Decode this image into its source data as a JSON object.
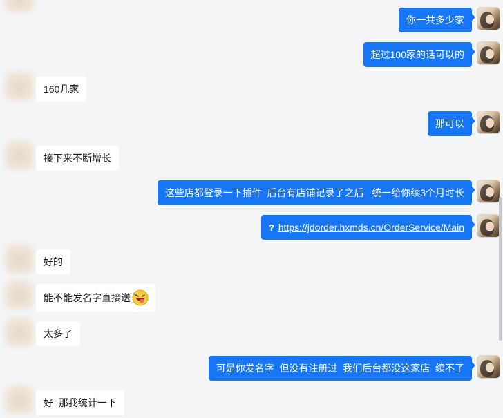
{
  "messages": [
    {
      "id": "m1",
      "side": "self",
      "text": "你一共多少家"
    },
    {
      "id": "m2",
      "side": "self",
      "text": "超过100家的话可以的"
    },
    {
      "id": "m3",
      "side": "other",
      "text": "160几家"
    },
    {
      "id": "m4",
      "side": "self",
      "text": "那可以"
    },
    {
      "id": "m5",
      "side": "other",
      "text": "接下来不断增长"
    },
    {
      "id": "m6",
      "side": "self",
      "text": "这些店都登录一下插件  后台有店铺记录了之后   统一给你续3个月时长"
    },
    {
      "id": "m7",
      "side": "self",
      "type": "link",
      "icon": "?",
      "url": "https://jdorder.hxmds.cn/OrderService/Main"
    },
    {
      "id": "m8",
      "side": "other",
      "text": "好的"
    },
    {
      "id": "m9",
      "side": "other",
      "text": "能不能发名字直接送",
      "emoji": "laughing-tongue-emoji"
    },
    {
      "id": "m10",
      "side": "other",
      "text": "太多了"
    },
    {
      "id": "m11",
      "side": "self",
      "text": "可是你发名字  但没有注册过  我们后台都没这家店  续不了"
    },
    {
      "id": "m12",
      "side": "other",
      "text": "好  那我统计一下"
    }
  ],
  "colors": {
    "background": "#f4f5f7",
    "self_bubble": "#1676f5",
    "other_bubble": "#ffffff",
    "self_text": "#ffffff",
    "other_text": "#1a1a1a"
  }
}
